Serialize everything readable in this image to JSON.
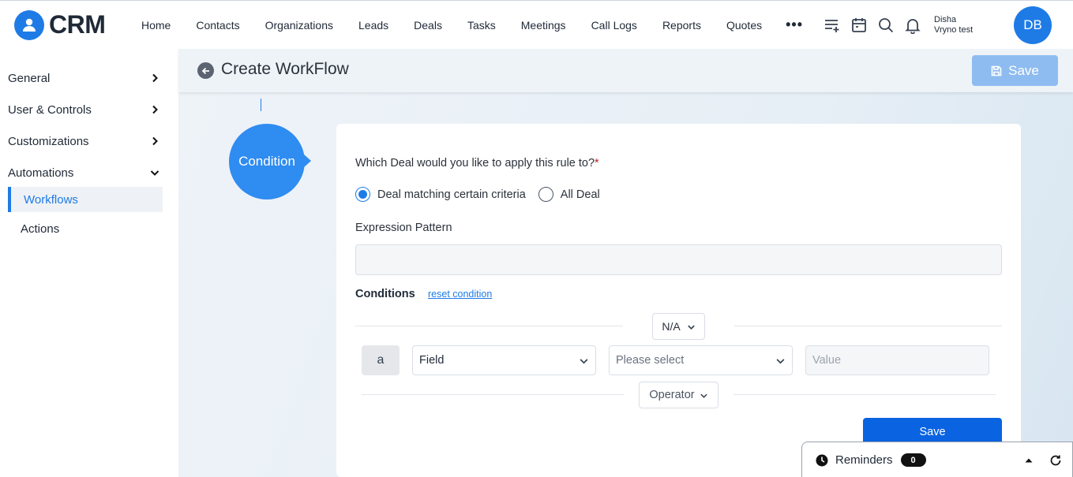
{
  "app": {
    "logo_text": "CRM"
  },
  "nav": {
    "items": [
      "Home",
      "Contacts",
      "Organizations",
      "Leads",
      "Deals",
      "Tasks",
      "Meetings",
      "Call Logs",
      "Reports",
      "Quotes"
    ],
    "more_label": "•••"
  },
  "user": {
    "first_name": "Disha",
    "last_name": "Vryno test",
    "initials": "DB"
  },
  "sidebar": {
    "sections": [
      {
        "label": "General",
        "state": "collapsed"
      },
      {
        "label": "User & Controls",
        "state": "collapsed"
      },
      {
        "label": "Customizations",
        "state": "collapsed"
      },
      {
        "label": "Automations",
        "state": "expanded"
      }
    ],
    "sub_items": [
      {
        "label": "Workflows",
        "active": true
      },
      {
        "label": "Actions",
        "active": false
      }
    ]
  },
  "header": {
    "title": "Create WorkFlow",
    "save_label": "Save"
  },
  "step": {
    "label": "Condition"
  },
  "form": {
    "question": "Which Deal would you like to apply this rule to?",
    "required_mark": "*",
    "radio_options": [
      {
        "label": "Deal matching certain criteria",
        "checked": true
      },
      {
        "label": "All Deal",
        "checked": false
      }
    ],
    "expression_label": "Expression Pattern",
    "expression_value": "",
    "conditions_label": "Conditions",
    "reset_link": "reset condition",
    "join_select": "N/A",
    "row_letter": "a",
    "field_select": "Field",
    "operator_select_placeholder": "Please select",
    "value_placeholder": "Value",
    "operator_label": "Operator",
    "save_label": "Save"
  },
  "reminders": {
    "label": "Reminders",
    "count": "0"
  },
  "colors": {
    "accent": "#1e7be6",
    "primary_button": "#0a63e0",
    "disabled_button": "#8fbcf0"
  }
}
